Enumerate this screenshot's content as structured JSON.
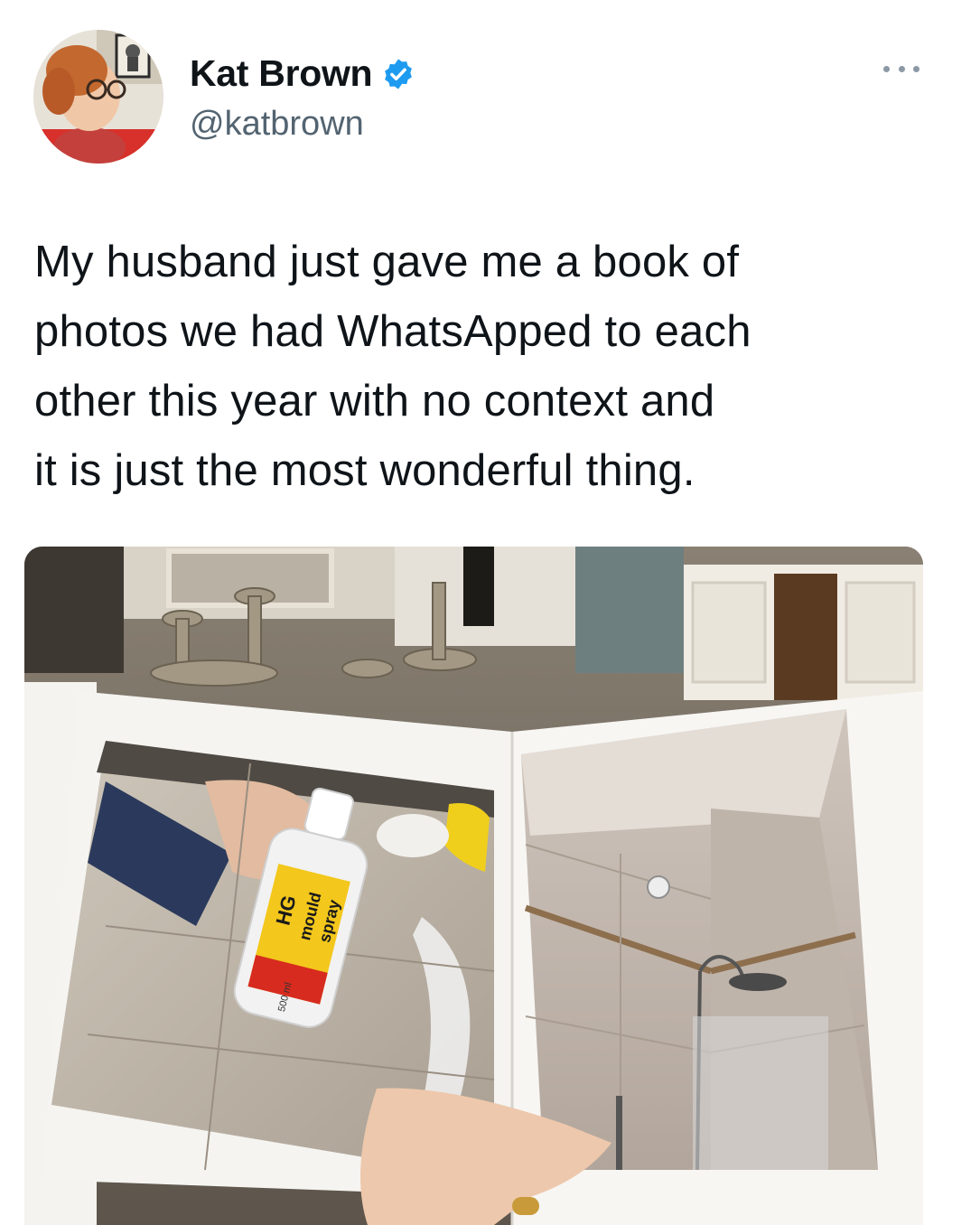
{
  "author": {
    "display_name": "Kat Brown",
    "handle": "@katbrown",
    "verified": true,
    "avatar_icon": "avatar-photo"
  },
  "tweet": {
    "text": "My husband just gave me a book of\nphotos we had WhatsApped to each\nother this year with no context and\nit is just the most wonderful thing."
  },
  "media": {
    "bottle_brand": "HG",
    "bottle_text_line1": "mould",
    "bottle_text_line2": "spray",
    "bottle_volume": "500 ml"
  },
  "colors": {
    "verified_badge": "#1d9bf0",
    "text_primary": "#0f1419",
    "text_secondary": "#536471"
  },
  "icons": {
    "verified": "verified-badge-icon",
    "more": "more-dots-icon"
  }
}
